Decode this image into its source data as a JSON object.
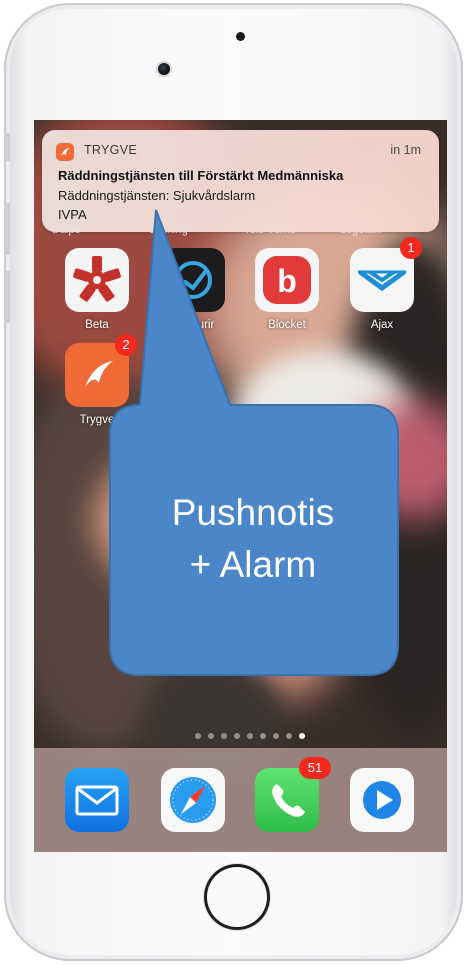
{
  "notification": {
    "app_name": "TRYGVE",
    "time": "in 1m",
    "title": "Räddningstjänsten till Förstärkt Medmänniska",
    "body_line1": "Räddningstjänsten: Sjukvårdslarm",
    "body_line2": "IVPA",
    "icon": "trygve-logo-icon"
  },
  "home_screen": {
    "hidden_labels": [
      "Daipo",
      "Uesking",
      "Tele Verne",
      "Logotaxi"
    ],
    "apps": [
      {
        "label": "Beta",
        "icon": "beta-asterisk-icon",
        "badge": ""
      },
      {
        "label": "urir",
        "icon": "kurir-arrow-icon",
        "badge": ""
      },
      {
        "label": "Blocket",
        "icon": "blocket-b-icon",
        "badge": ""
      },
      {
        "label": "Ajax",
        "icon": "ajax-chevron-icon",
        "badge": "1"
      },
      {
        "label": "Trygve",
        "icon": "trygve-logo-icon",
        "badge": "2"
      }
    ],
    "page_count": 9,
    "active_page": 9
  },
  "dock": {
    "apps": [
      {
        "name": "Mail",
        "icon": "mail-envelope-icon",
        "badge": ""
      },
      {
        "name": "Safari",
        "icon": "safari-compass-icon",
        "badge": ""
      },
      {
        "name": "Phone",
        "icon": "phone-handset-icon",
        "badge": "51"
      },
      {
        "name": "Video",
        "icon": "play-icon",
        "badge": ""
      }
    ]
  },
  "callout": {
    "line1": "Pushnotis",
    "line2": "+ Alarm",
    "color": "#4a86c8"
  },
  "colors": {
    "badge": "#f5281e",
    "trygve": "#f06a38",
    "blocket": "#e23a3a",
    "phone": "#4cd964",
    "mail": "#1d8bf0"
  }
}
